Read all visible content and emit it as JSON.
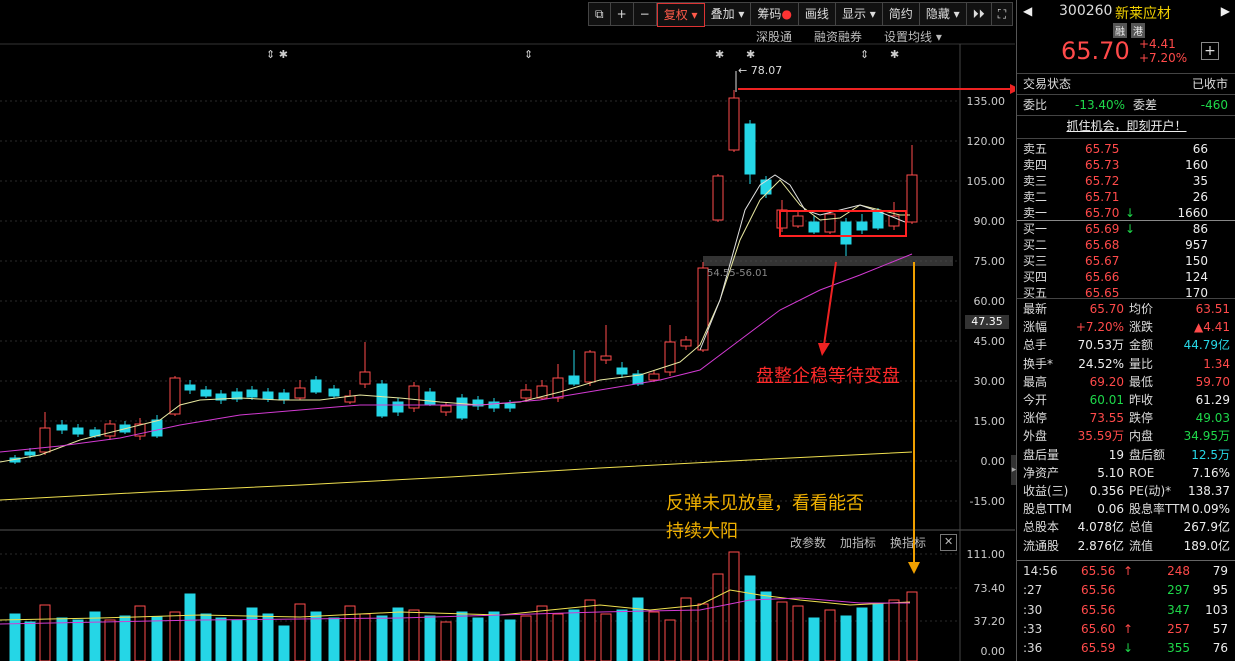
{
  "toolbar": {
    "items": [
      "复权",
      "叠加",
      "筹码",
      "画线",
      "显示",
      "简约",
      "隐藏"
    ],
    "restore_icon": "window-restore-icon",
    "plus_icon": "plus-icon",
    "minus_icon": "minus-icon",
    "expand_icon": "double-arrow-icon"
  },
  "subtoolbar": {
    "items": [
      "深股通",
      "融资融券",
      "设置均线"
    ]
  },
  "chart": {
    "high_label": "78.07",
    "gap_label": "54.55-56.01",
    "current_price_tag": "47.35",
    "y_ticks": [
      "135.00",
      "120.00",
      "105.00",
      "90.00",
      "75.00",
      "60.00",
      "45.00",
      "30.00",
      "15.00",
      "0.00",
      "-15.00"
    ],
    "annotation_1": "盘整企稳等待变盘",
    "annotation_2_line1": "反弹未见放量，看看能否",
    "annotation_2_line2": "持续大阳"
  },
  "volume": {
    "tools": [
      "改参数",
      "加指标",
      "换指标"
    ],
    "y_ticks": [
      "111.00",
      "73.40",
      "37.20",
      "0.00"
    ]
  },
  "stock": {
    "code": "300260",
    "name": "新莱应材",
    "tag1": "融",
    "tag2": "港",
    "price": "65.70",
    "change": "+4.41",
    "change_pct": "+7.20%",
    "trade_status_label": "交易状态",
    "trade_status": "已收市",
    "weibi_label": "委比",
    "weibi": "-13.40%",
    "weicha_label": "委差",
    "weicha": "-460",
    "promo": "抓住机会，即刻开户！"
  },
  "asks": [
    {
      "label": "卖五",
      "price": "65.75",
      "vol": "66"
    },
    {
      "label": "卖四",
      "price": "65.73",
      "vol": "160"
    },
    {
      "label": "卖三",
      "price": "65.72",
      "vol": "35"
    },
    {
      "label": "卖二",
      "price": "65.71",
      "vol": "26"
    },
    {
      "label": "卖一",
      "price": "65.70",
      "vol": "1660"
    }
  ],
  "bids": [
    {
      "label": "买一",
      "price": "65.69",
      "vol": "86"
    },
    {
      "label": "买二",
      "price": "65.68",
      "vol": "957"
    },
    {
      "label": "买三",
      "price": "65.67",
      "vol": "150"
    },
    {
      "label": "买四",
      "price": "65.66",
      "vol": "124"
    },
    {
      "label": "买五",
      "price": "65.65",
      "vol": "170"
    }
  ],
  "stats": [
    {
      "l1": "最新",
      "v1": "65.70",
      "c1": "red",
      "l2": "均价",
      "v2": "63.51",
      "c2": "red"
    },
    {
      "l1": "涨幅",
      "v1": "+7.20%",
      "c1": "red",
      "l2": "涨跌",
      "v2": "▲4.41",
      "c2": "red"
    },
    {
      "l1": "总手",
      "v1": "70.53万",
      "c1": "white",
      "l2": "金额",
      "v2": "44.79亿",
      "c2": "cyan"
    },
    {
      "l1": "换手*",
      "v1": "24.52%",
      "c1": "white",
      "l2": "量比",
      "v2": "1.34",
      "c2": "red"
    },
    {
      "l1": "最高",
      "v1": "69.20",
      "c1": "red",
      "l2": "最低",
      "v2": "59.70",
      "c2": "red"
    },
    {
      "l1": "今开",
      "v1": "60.01",
      "c1": "green",
      "l2": "昨收",
      "v2": "61.29",
      "c2": "white"
    },
    {
      "l1": "涨停",
      "v1": "73.55",
      "c1": "red",
      "l2": "跌停",
      "v2": "49.03",
      "c2": "green"
    },
    {
      "l1": "外盘",
      "v1": "35.59万",
      "c1": "red",
      "l2": "内盘",
      "v2": "34.95万",
      "c2": "green"
    },
    {
      "l1": "盘后量",
      "v1": "19",
      "c1": "white",
      "l2": "盘后额",
      "v2": "12.5万",
      "c2": "cyan"
    },
    {
      "l1": "净资产",
      "v1": "5.10",
      "c1": "white",
      "l2": "ROE",
      "v2": "7.16%",
      "c2": "white"
    },
    {
      "l1": "收益(三)",
      "v1": "0.356",
      "c1": "white",
      "l2": "PE(动)*",
      "v2": "138.37",
      "c2": "white"
    },
    {
      "l1": "股息TTM",
      "v1": "0.06",
      "c1": "white",
      "l2": "股息率TTM",
      "v2": "0.09%",
      "c2": "white"
    },
    {
      "l1": "总股本",
      "v1": "4.078亿",
      "c1": "white",
      "l2": "总值",
      "v2": "267.9亿",
      "c2": "white"
    },
    {
      "l1": "流通股",
      "v1": "2.876亿",
      "c1": "white",
      "l2": "流值",
      "v2": "189.0亿",
      "c2": "white"
    }
  ],
  "ticks": [
    {
      "time": "14:56",
      "price": "65.56",
      "arrow": "↑",
      "vol": "248",
      "n": "79",
      "vc": "red"
    },
    {
      "time": ":27",
      "price": "65.56",
      "arrow": "",
      "vol": "297",
      "n": "95",
      "vc": "green"
    },
    {
      "time": ":30",
      "price": "65.56",
      "arrow": "",
      "vol": "347",
      "n": "103",
      "vc": "green"
    },
    {
      "time": ":33",
      "price": "65.60",
      "arrow": "↑",
      "vol": "257",
      "n": "57",
      "vc": "red"
    },
    {
      "time": ":36",
      "price": "65.59",
      "arrow": "↓",
      "vol": "355",
      "n": "76",
      "vc": "green"
    }
  ]
}
